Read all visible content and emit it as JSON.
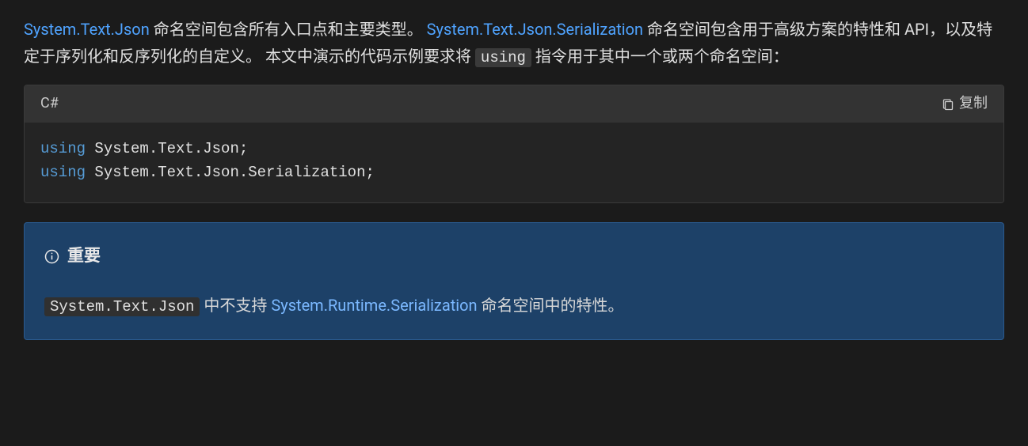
{
  "paragraph": {
    "link1": "System.Text.Json",
    "text1": " 命名空间包含所有入口点和主要类型。 ",
    "link2": "System.Text.Json.Serialization",
    "text2": " 命名空间包含用于高级方案的特性和 API，以及特定于序列化和反序列化的自定义。 本文中演示的代码示例要求将 ",
    "code_inline": "using",
    "text3": " 指令用于其中一个或两个命名空间："
  },
  "code_block": {
    "language": "C#",
    "copy_label": "复制",
    "lines": [
      {
        "keyword": "using",
        "rest": " System.Text.Json;"
      },
      {
        "keyword": "using",
        "rest": " System.Text.Json.Serialization;"
      }
    ]
  },
  "alert": {
    "title": "重要",
    "code": "System.Text.Json",
    "text_before_link": " 中不支持 ",
    "link": "System.Runtime.Serialization",
    "text_after_link": " 命名空间中的特性。"
  }
}
